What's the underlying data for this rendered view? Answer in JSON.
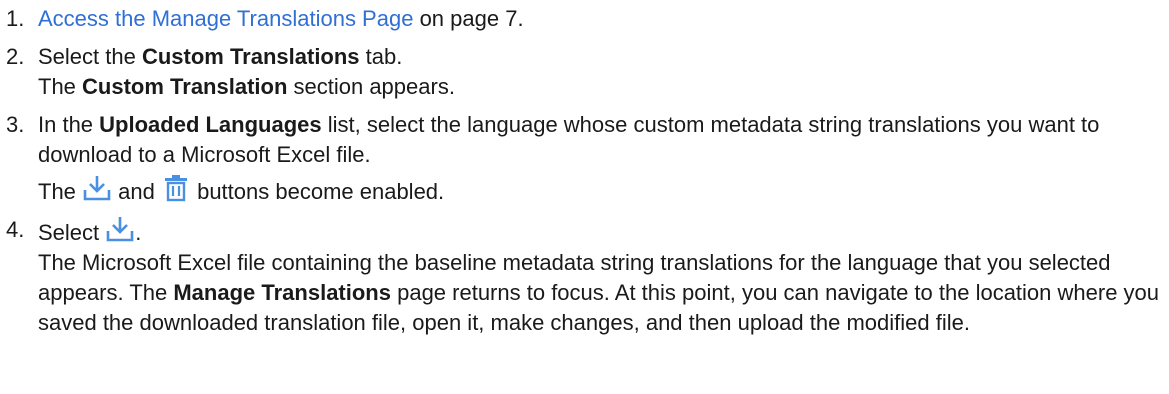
{
  "steps": [
    {
      "number": "1.",
      "link_text": "Access the Manage Translations Page",
      "after_link": " on page 7."
    },
    {
      "number": "2.",
      "pre": "Select the ",
      "bold": "Custom Translations",
      "post": " tab.",
      "result_pre": "The ",
      "result_bold": "Custom Translation",
      "result_post": " section appears."
    },
    {
      "number": "3.",
      "pre": "In the ",
      "bold": "Uploaded Languages",
      "post": " list, select the language whose custom metadata string translations you want to download to a Microsoft Excel file.",
      "result_pre": "The ",
      "result_mid": " and ",
      "result_post": " buttons become enabled."
    },
    {
      "number": "4.",
      "pre": "Select ",
      "post": ".",
      "result_pre": "The Microsoft Excel file containing the baseline metadata string translations for the language that you selected appears. The ",
      "result_bold": "Manage Translations",
      "result_post": " page returns to focus. At this point, you can navigate to the location where you saved the downloaded translation file, open it, make changes, and then upload the modified file."
    }
  ],
  "colors": {
    "link": "#2f6fd6",
    "icon": "#4a90e2"
  },
  "icons": {
    "download": "download-icon",
    "delete": "trash-icon"
  }
}
